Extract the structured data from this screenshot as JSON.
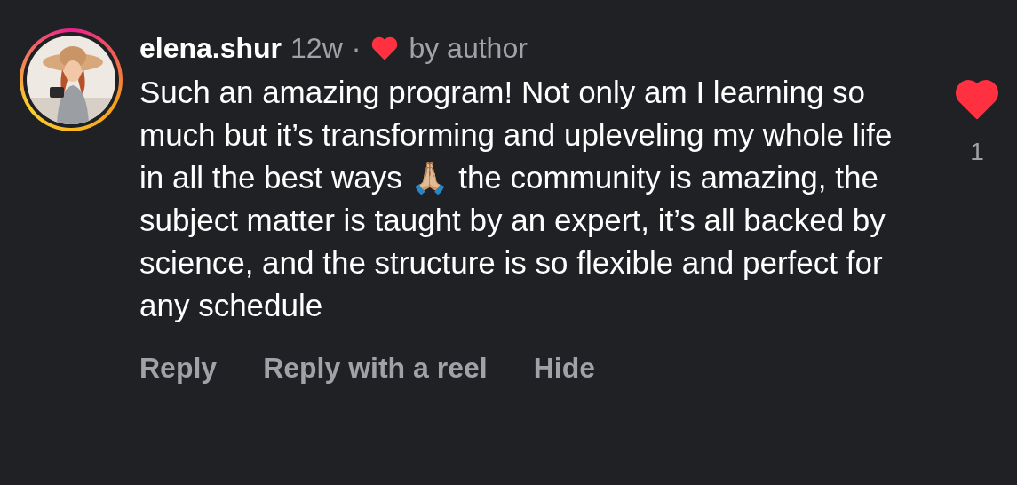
{
  "comment": {
    "username": "elena.shur",
    "age": "12w",
    "separator": "·",
    "author_liked": true,
    "author_label": "by author",
    "text": "Such an amazing program! Not only am I learning so much but it’s transforming and upleveling my whole life in all the best ways 🙏🏼 the community is amazing, the subject matter is taught by an expert, it’s all backed by science, and the structure is so flexible and perfect for any schedule",
    "liked": true,
    "like_count": "1",
    "actions": [
      "Reply",
      "Reply with a reel",
      "Hide"
    ]
  }
}
